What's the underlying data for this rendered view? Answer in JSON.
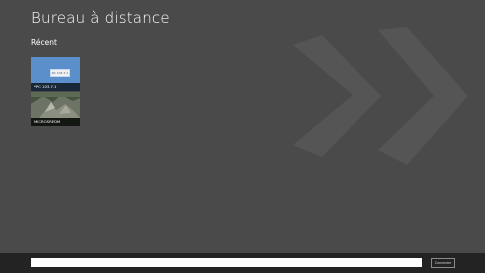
{
  "app": {
    "title": "Bureau à distance"
  },
  "recent": {
    "section_title": "Récent",
    "tiles": [
      {
        "label": "*PC 103.7.1",
        "preview_text": "PC 103.7.1"
      },
      {
        "label": "MICROSREDM"
      }
    ]
  },
  "connect_bar": {
    "input_value": "",
    "button_label": "Connecter"
  },
  "colors": {
    "background": "#4a4a4a",
    "bottom_bar": "#232323",
    "tile_blue": "#5a8fcb"
  }
}
